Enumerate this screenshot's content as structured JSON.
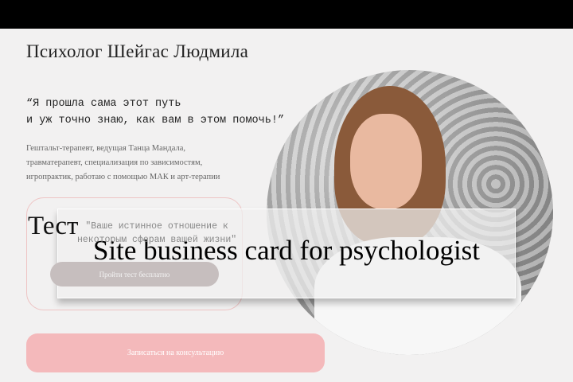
{
  "header": {
    "title": "Психолог Шейгас Людмила"
  },
  "quote": {
    "line1": "“Я прошла сама этот путь",
    "line2": "и уж точно знаю, как вам в этом помочь!”"
  },
  "description": {
    "line1": "Гештальт-терапевт, ведущая Танца Мандала,",
    "line2": "травматерапевт, специализация по зависимостям,",
    "line3": "игропрактик, работаю с помощью МАК и арт-терапии"
  },
  "test": {
    "title": "Тест",
    "subtitle_line1": "\"Ваше истинное отношение к",
    "subtitle_line2": "некоторым сферам вашей жизни\"",
    "button": "Пройти тест бесплатно"
  },
  "overlay": {
    "caption": "Site business card for psychologist"
  },
  "cta": {
    "button": "Записаться на консультацию"
  },
  "colors": {
    "accent": "#f4b9bb",
    "background": "#f2f1f1"
  }
}
